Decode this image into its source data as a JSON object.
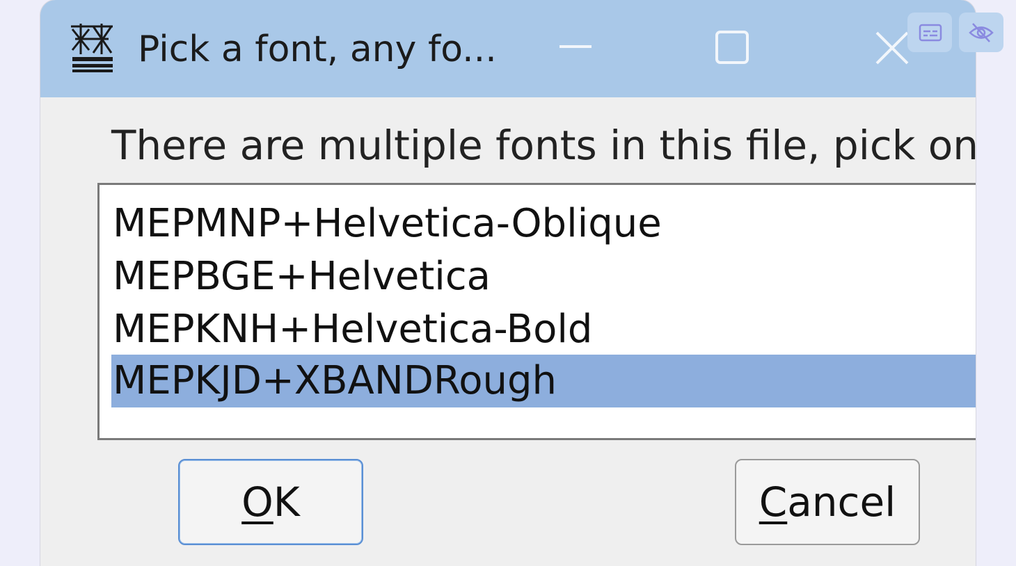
{
  "window": {
    "title": "Pick a font, any fo...",
    "app_icon": "fontforge-icon",
    "controls": {
      "minimize_icon": "minimize-icon",
      "maximize_icon": "maximize-icon",
      "close_icon": "close-icon"
    }
  },
  "overlay": {
    "buttons": [
      {
        "icon": "captions-icon"
      },
      {
        "icon": "eye-off-icon"
      }
    ]
  },
  "dialog": {
    "prompt": "There are multiple fonts in this file, pick one",
    "fonts": [
      {
        "label": "MEPMNP+Helvetica-Oblique",
        "selected": false
      },
      {
        "label": "MEPBGE+Helvetica",
        "selected": false
      },
      {
        "label": "MEPKNH+Helvetica-Bold",
        "selected": false
      },
      {
        "label": "MEPKJD+XBANDRough",
        "selected": true
      }
    ],
    "ok_button": {
      "mnemonic": "O",
      "rest": "K"
    },
    "cancel_button": {
      "mnemonic": "C",
      "rest": "ancel"
    }
  },
  "colors": {
    "titlebar": "#a9c8e8",
    "selection": "#8daedd",
    "default_button_border": "#5a8fd4"
  }
}
